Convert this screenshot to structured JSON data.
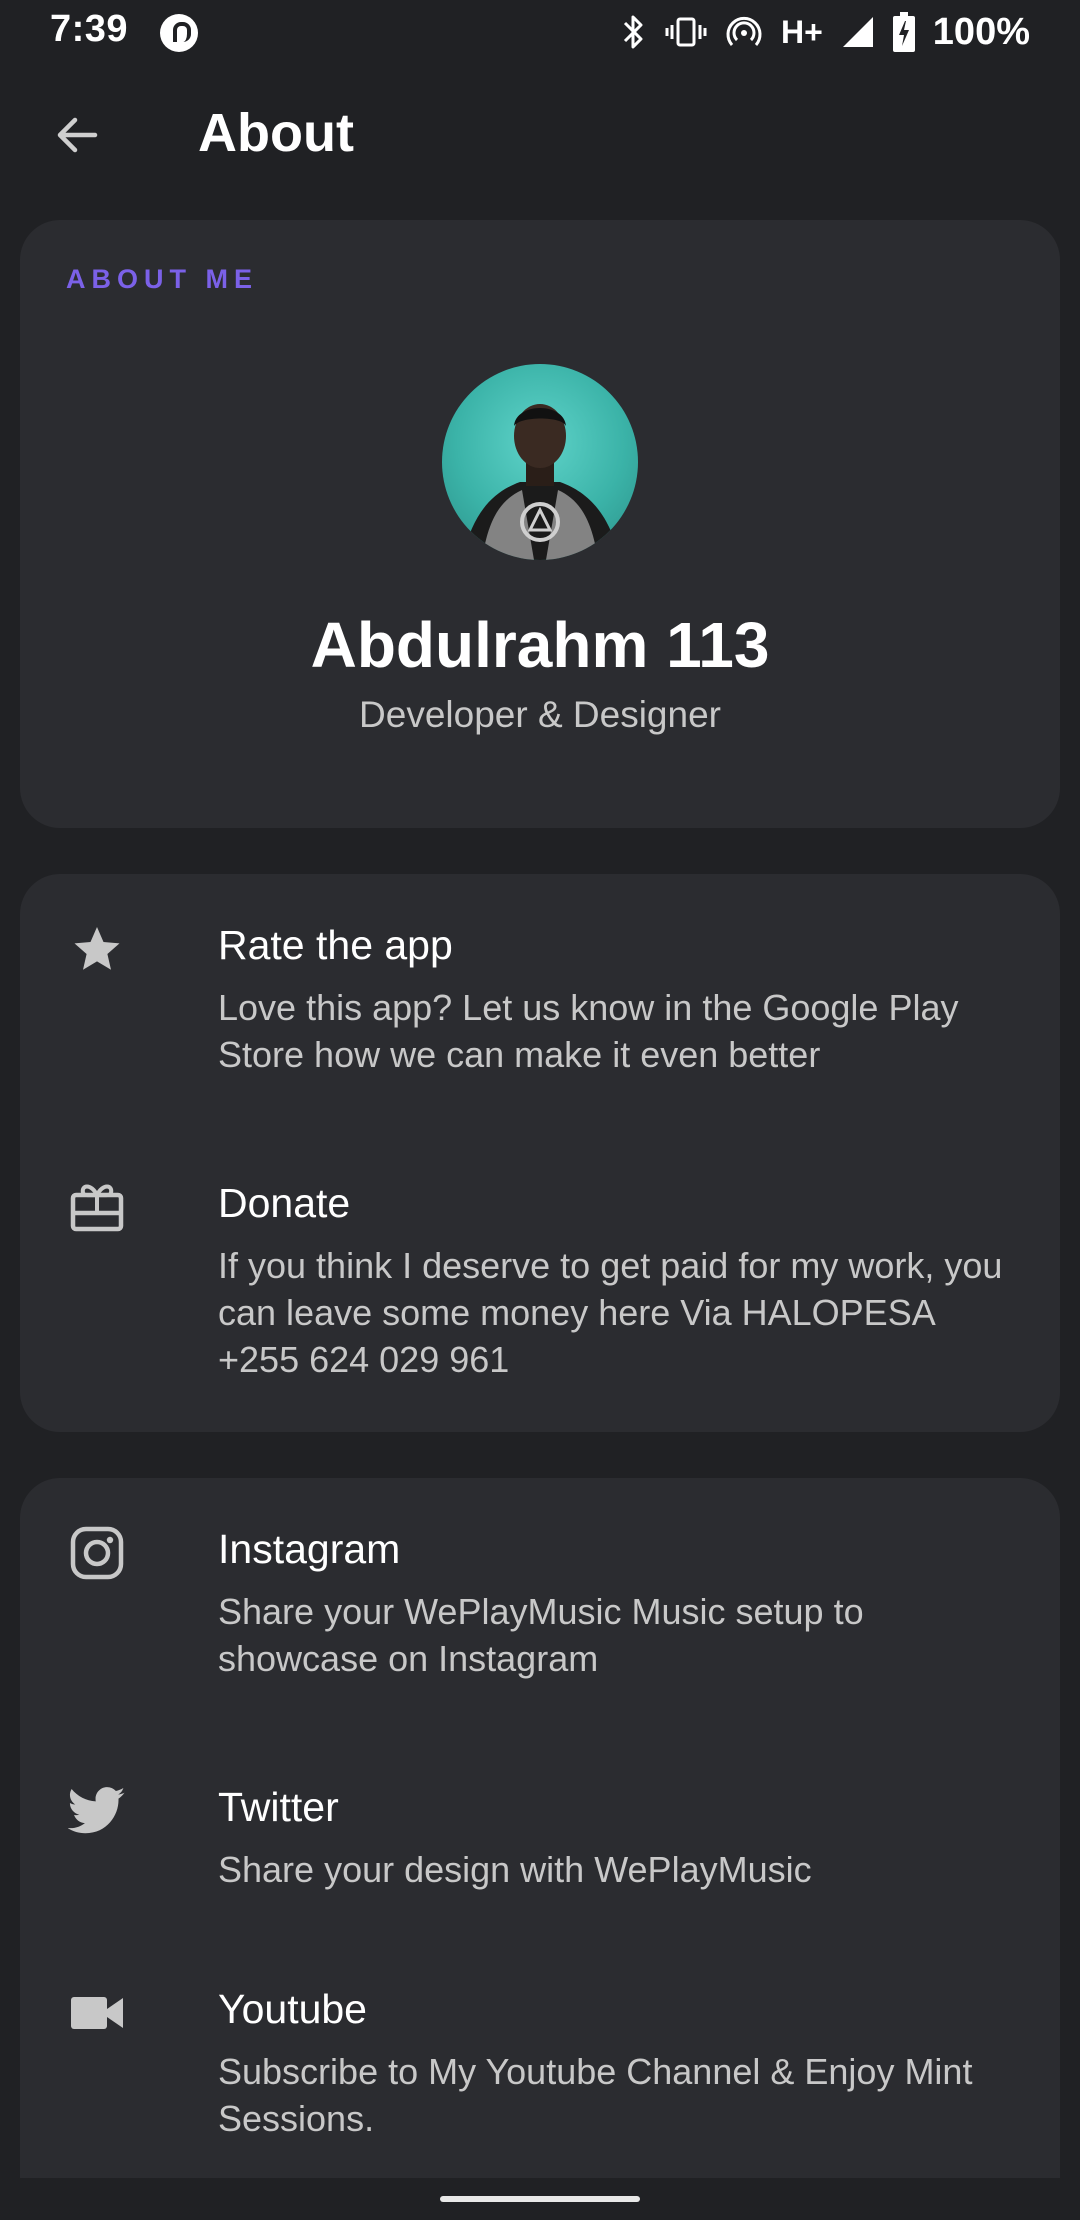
{
  "status_bar": {
    "time": "7:39",
    "network": "H+",
    "battery": "100%"
  },
  "app_bar": {
    "title": "About"
  },
  "about_card": {
    "section_label": "ABOUT ME",
    "name": "Abdulrahm 113",
    "role": "Developer & Designer"
  },
  "actions": [
    {
      "icon": "star-icon",
      "title": "Rate the app",
      "subtitle": "Love this app? Let us know in the Google Play Store how we can make it even better"
    },
    {
      "icon": "gift-icon",
      "title": "Donate",
      "subtitle": "If you think I deserve to get paid for my work, you can leave some money here Via HALOPESA +255 624 029 961"
    }
  ],
  "social": [
    {
      "icon": "instagram-icon",
      "title": "Instagram",
      "subtitle": "Share your WePlayMusic Music setup to showcase on Instagram"
    },
    {
      "icon": "twitter-icon",
      "title": "Twitter",
      "subtitle": "Share your design with WePlayMusic"
    },
    {
      "icon": "video-camera-icon",
      "title": "Youtube",
      "subtitle": "Subscribe to My Youtube Channel & Enjoy Mint Sessions."
    }
  ],
  "colors": {
    "background": "#202124",
    "card": "#2b2c30",
    "accent": "#7b61e8",
    "secondary_text": "#c8c8c8"
  }
}
